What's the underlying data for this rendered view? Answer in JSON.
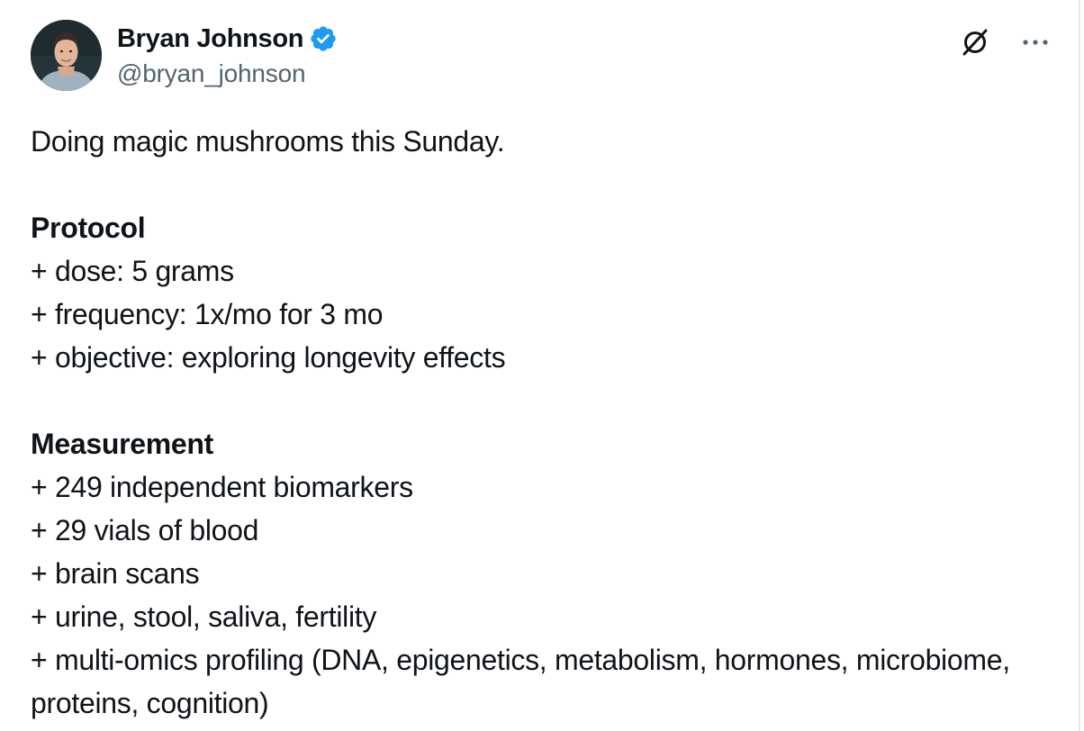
{
  "author": {
    "display_name": "Bryan Johnson",
    "handle": "@bryan_johnson",
    "verified": true
  },
  "icons": {
    "avatar": "profile-photo",
    "verified": "verified-badge-icon",
    "grok": "grok-icon",
    "more": "more-options-icon"
  },
  "colors": {
    "verified_blue": "#1d9bf0",
    "text_primary": "#0f1419",
    "text_secondary": "#536471"
  },
  "post": {
    "intro": "Doing magic mushrooms this Sunday.",
    "protocol": {
      "heading": "Protocol",
      "items": [
        "+ dose: 5 grams",
        "+ frequency: 1x/mo for 3 mo",
        "+ objective: exploring longevity effects"
      ]
    },
    "measurement": {
      "heading": "Measurement",
      "items": [
        "+ 249 independent biomarkers",
        "+ 29 vials of blood",
        "+ brain scans",
        "+ urine, stool, saliva, fertility",
        "+ multi-omics profiling (DNA, epigenetics, metabolism, hormones, microbiome, proteins, cognition)"
      ]
    }
  }
}
